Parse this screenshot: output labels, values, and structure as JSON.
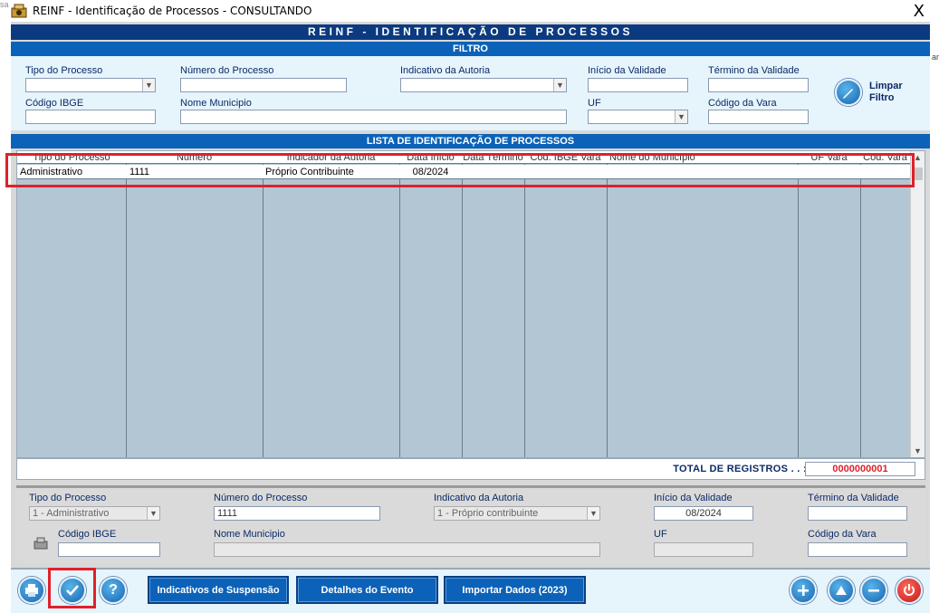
{
  "window": {
    "title": "REINF - Identificação de Processos  -  CONSULTANDO",
    "close": "X"
  },
  "edges": {
    "left": "sa",
    "right": "ar"
  },
  "header": {
    "main": "REINF - IDENTIFICAÇÃO DE PROCESSOS",
    "filter": "FILTRO"
  },
  "filter": {
    "tipo_processo": {
      "label": "Tipo do Processo",
      "value": ""
    },
    "numero_processo": {
      "label": "Número do Processo",
      "value": ""
    },
    "indicativo_autoria": {
      "label": "Indicativo da Autoria",
      "value": ""
    },
    "inicio_validade": {
      "label": "Início da Validade",
      "value": ""
    },
    "termino_validade": {
      "label": "Término da Validade",
      "value": ""
    },
    "codigo_ibge": {
      "label": "Código IBGE",
      "value": ""
    },
    "nome_municipio": {
      "label": "Nome Municipio",
      "value": ""
    },
    "uf": {
      "label": "UF",
      "value": ""
    },
    "codigo_vara": {
      "label": "Código da Vara",
      "value": ""
    },
    "limpar_line1": "Limpar",
    "limpar_line2": "Filtro"
  },
  "list": {
    "title": "LISTA DE IDENTIFICAÇÃO DE PROCESSOS",
    "columns": [
      "Tipo do Processo",
      "Número",
      "Indicador da Autoria",
      "Data Início",
      "Data Término",
      "Cód. IBGE Vara",
      "Nome do Município",
      "UF Vara",
      "Cód. Vara"
    ],
    "rows": [
      [
        "Administrativo",
        "1111",
        "Próprio Contribuinte",
        "08/2024",
        "",
        "",
        "",
        "",
        ""
      ]
    ],
    "total_label": "TOTAL DE REGISTROS . . :",
    "total_value": "0000000001"
  },
  "detail": {
    "tipo_processo": {
      "label": "Tipo do Processo",
      "value": "1 - Administrativo"
    },
    "numero_processo": {
      "label": "Número do Processo",
      "value": "1111"
    },
    "indicativo_autoria": {
      "label": "Indicativo da Autoria",
      "value": "1 - Próprio contribuinte"
    },
    "inicio_validade": {
      "label": "Início da Validade",
      "value": "08/2024"
    },
    "termino_validade": {
      "label": "Término da Validade",
      "value": ""
    },
    "codigo_ibge": {
      "label": "Código IBGE",
      "value": ""
    },
    "nome_municipio": {
      "label": "Nome Municipio",
      "value": ""
    },
    "uf": {
      "label": "UF",
      "value": ""
    },
    "codigo_vara": {
      "label": "Código da Vara",
      "value": ""
    }
  },
  "toolbar": {
    "indicativos_suspensao": "Indicativos de Suspensão",
    "detalhes_evento": "Detalhes do Evento",
    "importar_dados": "Importar Dados (2023)",
    "help": "?"
  },
  "colors": {
    "accent": "#0b62b8",
    "header_dark": "#0b3a80",
    "highlight": "#e0202a",
    "total_value": "#e0202a"
  }
}
